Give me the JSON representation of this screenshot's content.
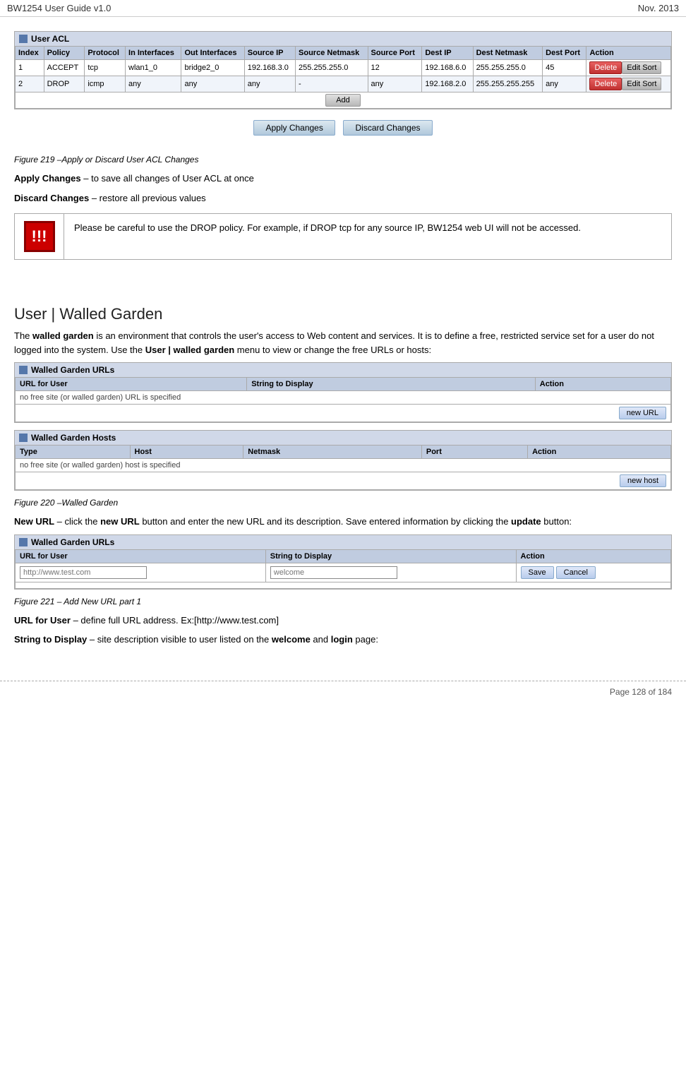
{
  "header": {
    "title": "BW1254 User Guide v1.0",
    "date": "Nov.  2013"
  },
  "acl_section": {
    "title": "User ACL",
    "columns": [
      "Index",
      "Policy",
      "Protocol",
      "In Interfaces",
      "Out Interfaces",
      "Source IP",
      "Source Netmask",
      "Source Port",
      "Dest IP",
      "Dest Netmask",
      "Dest Port",
      "Action"
    ],
    "rows": [
      {
        "index": "1",
        "policy": "ACCEPT",
        "protocol": "tcp",
        "in_interfaces": "wlan1_0",
        "out_interfaces": "bridge2_0",
        "source_ip": "192.168.3.0",
        "source_netmask": "255.255.255.0",
        "source_port": "12",
        "dest_ip": "192.168.6.0",
        "dest_netmask": "255.255.255.0",
        "dest_port": "45",
        "btn_delete": "Delete",
        "btn_edit": "Edit Sort"
      },
      {
        "index": "2",
        "policy": "DROP",
        "protocol": "icmp",
        "in_interfaces": "any",
        "out_interfaces": "any",
        "source_ip": "any",
        "source_netmask": "-",
        "source_port": "any",
        "dest_ip": "192.168.2.0",
        "dest_netmask": "255.255.255.255",
        "dest_port": "any",
        "btn_delete": "Delete",
        "btn_edit": "Edit Sort"
      }
    ],
    "btn_add": "Add"
  },
  "apply_section": {
    "btn_apply": "Apply Changes",
    "btn_discard": "Discard Changes"
  },
  "figure219": "Figure 219 –Apply or Discard User ACL Changes",
  "apply_desc": "Apply Changes",
  "apply_desc_rest": " – to save all changes of User ACL at once",
  "discard_desc": "Discard Changes",
  "discard_desc_rest": " – restore all previous values",
  "warning": {
    "icon": "!!!",
    "text": "Please be careful to use the DROP policy. For example, if DROP tcp for any source IP, BW1254 web UI will not be accessed."
  },
  "walled_garden_heading": "User | Walled Garden",
  "wg_intro": "The ",
  "wg_bold1": "walled garden",
  "wg_intro2": " is an environment that controls the user's access to Web content and services. It is to define a free, restricted service set for a user do not logged into the system. Use the ",
  "wg_bold2": "User | walled garden",
  "wg_intro3": " menu to view or change the free URLs or hosts:",
  "wg_urls_section": {
    "title": "Walled Garden URLs",
    "columns": [
      "URL for User",
      "String to Display",
      "Action"
    ],
    "no_site_text": "no free site (or walled garden) URL is specified",
    "btn_new_url": "new URL"
  },
  "wg_hosts_section": {
    "title": "Walled Garden Hosts",
    "columns": [
      "Type",
      "Host",
      "Netmask",
      "Port",
      "Action"
    ],
    "no_host_text": "no free site (or walled garden) host is specified",
    "btn_new_host": "new host"
  },
  "figure220": "Figure 220 –Walled Garden",
  "new_url_desc": "New URL",
  "new_url_desc_rest": " – click the ",
  "new_url_bold": "new URL",
  "new_url_desc2": " button and enter the new URL and its description. Save entered information by clicking the ",
  "new_url_bold2": "update",
  "new_url_desc3": " button:",
  "wg_form_section": {
    "title": "Walled Garden URLs",
    "columns": [
      "URL for User",
      "String to Display",
      "Action"
    ],
    "url_placeholder": "http://www.test.com",
    "display_placeholder": "welcome",
    "btn_save": "Save",
    "btn_cancel": "Cancel"
  },
  "figure221": "Figure 221 – Add New URL part 1",
  "url_for_user_label": "URL for User",
  "url_for_user_desc": " – define full URL address. Ex:[http://www.test.com]",
  "string_to_display_label": "String to Display",
  "string_to_display_desc": " – site description visible to user listed on the ",
  "string_bold1": "welcome",
  "string_desc2": " and ",
  "string_bold2": "login",
  "string_desc3": " page:",
  "footer": {
    "text": "Page 128 of 184"
  }
}
